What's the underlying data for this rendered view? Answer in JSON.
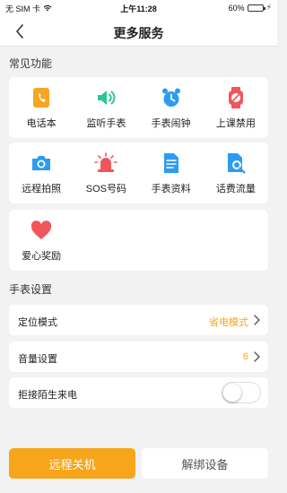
{
  "status_bar": {
    "carrier": "无 SIM 卡",
    "time": "上午11:28",
    "battery": "60%",
    "battery_level": 0.6
  },
  "nav": {
    "title": "更多服务"
  },
  "common_functions": {
    "section_title": "常见功能",
    "items": [
      {
        "label": "电话本",
        "icon": "phonebook-icon",
        "color": "#f5a623"
      },
      {
        "label": "监听手表",
        "icon": "speaker-icon",
        "color": "#2cc78f"
      },
      {
        "label": "手表闹钟",
        "icon": "alarm-clock-icon",
        "color": "#2d9cf0"
      },
      {
        "label": "上课禁用",
        "icon": "watch-disabled-icon",
        "color": "#f0565c"
      },
      {
        "label": "远程拍照",
        "icon": "camera-icon",
        "color": "#2d9cf0"
      },
      {
        "label": "SOS号码",
        "icon": "siren-icon",
        "color": "#f0565c"
      },
      {
        "label": "手表资料",
        "icon": "document-icon",
        "color": "#2d9cf0"
      },
      {
        "label": "话费流量",
        "icon": "data-usage-icon",
        "color": "#2d9cf0"
      },
      {
        "label": "爱心奖励",
        "icon": "heart-icon",
        "color": "#f0565c"
      }
    ]
  },
  "watch_settings": {
    "section_title": "手表设置",
    "location_mode": {
      "label": "定位模式",
      "value": "省电模式"
    },
    "volume": {
      "label": "音量设置",
      "value": "6"
    },
    "reject_strangers": {
      "label": "拒接陌生来电",
      "enabled": false
    }
  },
  "actions": {
    "shutdown": "远程关机",
    "unbind": "解绑设备"
  },
  "colors": {
    "accent": "#f7a51a",
    "value_text": "#f7a51a"
  }
}
